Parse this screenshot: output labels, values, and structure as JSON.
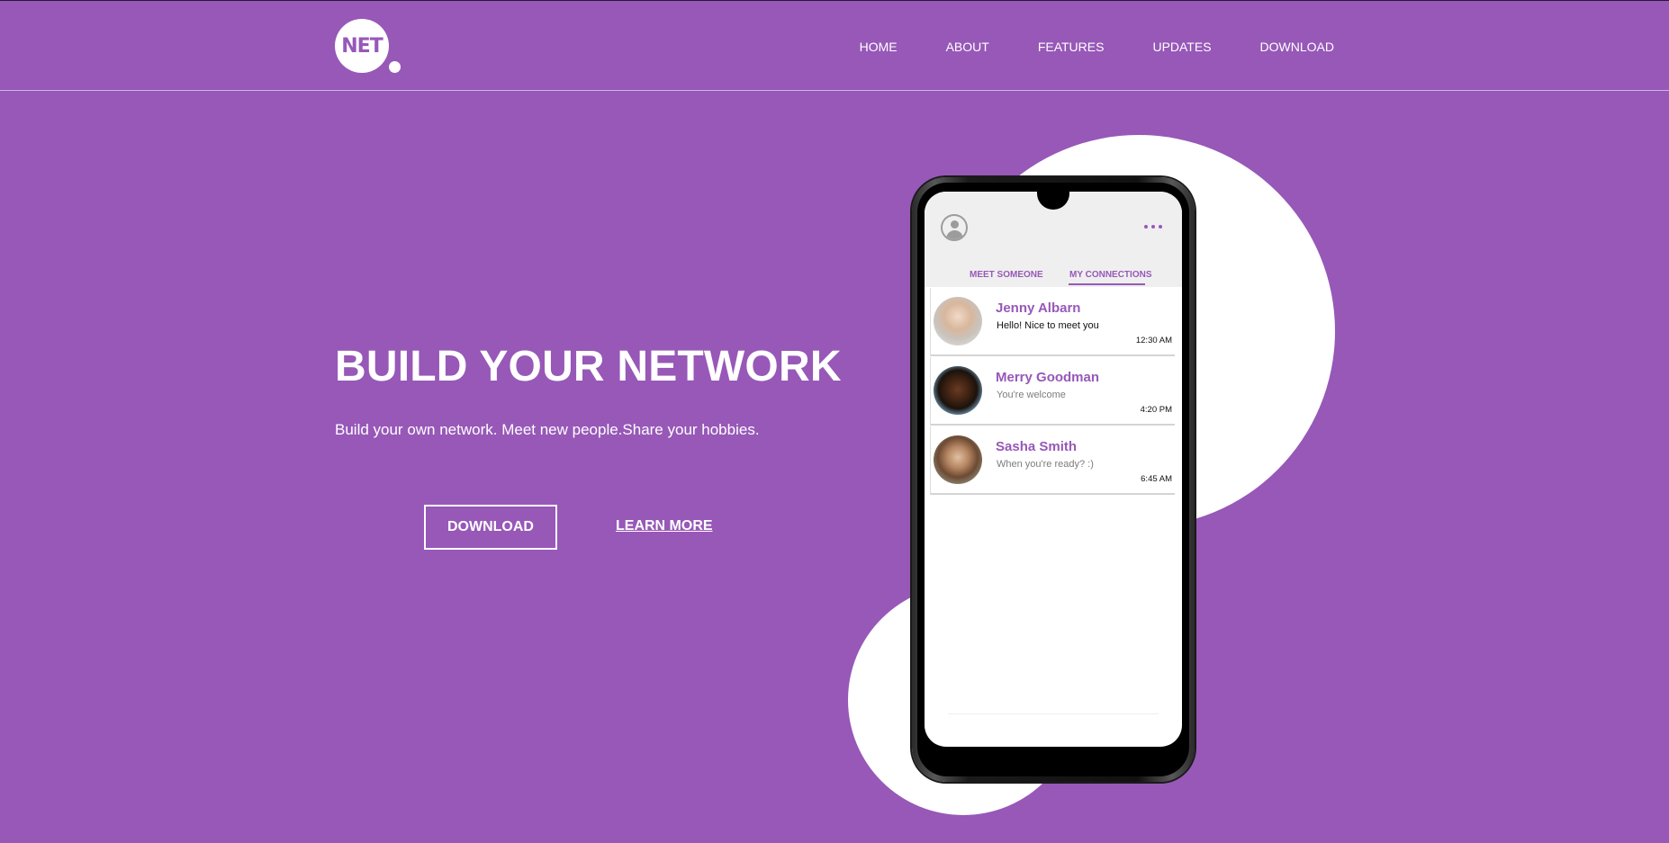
{
  "header": {
    "logo_text": "NET",
    "nav": [
      "HOME",
      "ABOUT",
      "FEATURES",
      "UPDATES",
      "DOWNLOAD"
    ]
  },
  "hero": {
    "title": "BUILD YOUR NETWORK",
    "subtitle": "Build your own network. Meet new people.Share your hobbies.",
    "download_label": "DOWNLOAD",
    "learn_more_label": "LEARN MORE"
  },
  "phone": {
    "tabs": [
      "MEET SOMEONE",
      "MY CONNECTIONS"
    ],
    "active_tab": "MY CONNECTIONS",
    "connections": [
      {
        "name": "Jenny Albarn",
        "message": "Hello! Nice to meet you",
        "time": "12:30 AM",
        "unread": true
      },
      {
        "name": "Merry Goodman",
        "message": "You're welcome",
        "time": "4:20 PM",
        "unread": false
      },
      {
        "name": "Sasha Smith",
        "message": "When you're ready? :)",
        "time": "6:45 AM",
        "unread": false
      }
    ]
  },
  "colors": {
    "background": "#9758b8",
    "accent": "#9758b8",
    "text": "#ffffff"
  },
  "icons": [
    "profile-icon",
    "more-dots-icon"
  ]
}
